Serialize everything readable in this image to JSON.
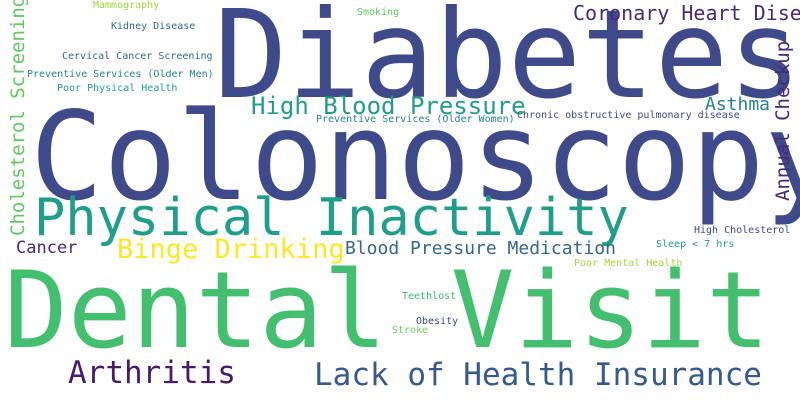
{
  "words": [
    {
      "id": "diabetes",
      "text": "Diabetes",
      "color": "#3e4a89"
    },
    {
      "id": "colonoscopy",
      "text": "Colonoscopy",
      "color": "#3e4a89"
    },
    {
      "id": "dental-visit",
      "text": "Dental Visit",
      "color": "#44bf70"
    },
    {
      "id": "physical-inactivity",
      "text": "Physical Inactivity",
      "color": "#1f9e89"
    },
    {
      "id": "lack-of-health-insurance",
      "text": "Lack of Health Insurance",
      "color": "#375a8c"
    },
    {
      "id": "arthritis",
      "text": "Arthritis",
      "color": "#481a6c"
    },
    {
      "id": "binge-drinking",
      "text": "Binge Drinking",
      "color": "#fde725"
    },
    {
      "id": "high-blood-pressure",
      "text": "High Blood Pressure",
      "color": "#1f9e89"
    },
    {
      "id": "coronary-heart-disease",
      "text": "Coronary Heart Disease",
      "color": "#482878"
    },
    {
      "id": "cholesterol-screening",
      "text": "Cholesterol Screening",
      "color": "#5ec962"
    },
    {
      "id": "annual-checkup",
      "text": "Annual Checkup",
      "color": "#482878"
    },
    {
      "id": "blood-pressure-medication",
      "text": "Blood Pressure Medication",
      "color": "#31688e"
    },
    {
      "id": "asthma",
      "text": "Asthma",
      "color": "#26828e"
    },
    {
      "id": "cancer",
      "text": "Cancer",
      "color": "#482878"
    },
    {
      "id": "mammography",
      "text": "Mammography",
      "color": "#a0da39"
    },
    {
      "id": "kidney-disease",
      "text": "Kidney Disease",
      "color": "#31688e"
    },
    {
      "id": "smoking",
      "text": "Smoking",
      "color": "#5ec962"
    },
    {
      "id": "cervical-cancer-screening",
      "text": "Cervical Cancer Screening",
      "color": "#31688e"
    },
    {
      "id": "preventive-services-older-men",
      "text": "Preventive Services (Older Men)",
      "color": "#26828e"
    },
    {
      "id": "poor-physical-health",
      "text": "Poor Physical Health",
      "color": "#1f9e89"
    },
    {
      "id": "preventive-services-older-women",
      "text": "Preventive Services (Older Women)",
      "color": "#26828e"
    },
    {
      "id": "chronic-obstructive-pulmonary-disease",
      "text": "Chronic obstructive pulmonary disease",
      "color": "#3e4a89"
    },
    {
      "id": "high-cholesterol",
      "text": "High Cholesterol",
      "color": "#3e4a89"
    },
    {
      "id": "sleep-under-7-hrs",
      "text": "Sleep < 7 hrs",
      "color": "#1f9e89"
    },
    {
      "id": "poor-mental-health",
      "text": "Poor Mental Health",
      "color": "#a0da39"
    },
    {
      "id": "teethlost",
      "text": "Teethlost",
      "color": "#35b779"
    },
    {
      "id": "obesity",
      "text": "Obesity",
      "color": "#3e4a89"
    },
    {
      "id": "stroke",
      "text": "Stroke",
      "color": "#6ece58"
    }
  ]
}
